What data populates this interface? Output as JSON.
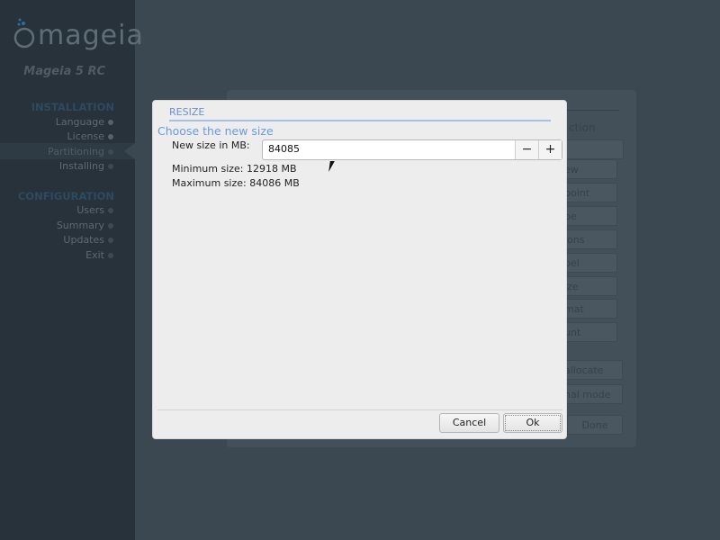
{
  "sidebar": {
    "brand": "mageia",
    "version": "Mageia 5 RC",
    "sections": [
      {
        "title": "INSTALLATION",
        "items": [
          "Language",
          "License",
          "Partitioning",
          "Installing"
        ]
      },
      {
        "title": "CONFIGURATION",
        "items": [
          "Users",
          "Summary",
          "Updates",
          "Exit"
        ]
      }
    ],
    "active_item": "Partitioning"
  },
  "background_panel": {
    "heading_fragment": "ction",
    "buttons": [
      "ew",
      "point",
      "pe",
      "ions",
      "bel",
      "ize",
      "mat",
      "unt"
    ],
    "auto_allocate": "allocate",
    "mode": "nal mode",
    "done": "Done"
  },
  "dialog": {
    "title": "RESIZE",
    "subtitle": "Choose the new size",
    "size_label": "New size in MB:",
    "size_value": "84085",
    "minus": "−",
    "plus": "+",
    "min_size": "Minimum size: 12918 MB",
    "max_size": "Maximum size: 84086 MB",
    "cancel": "Cancel",
    "ok": "Ok"
  }
}
